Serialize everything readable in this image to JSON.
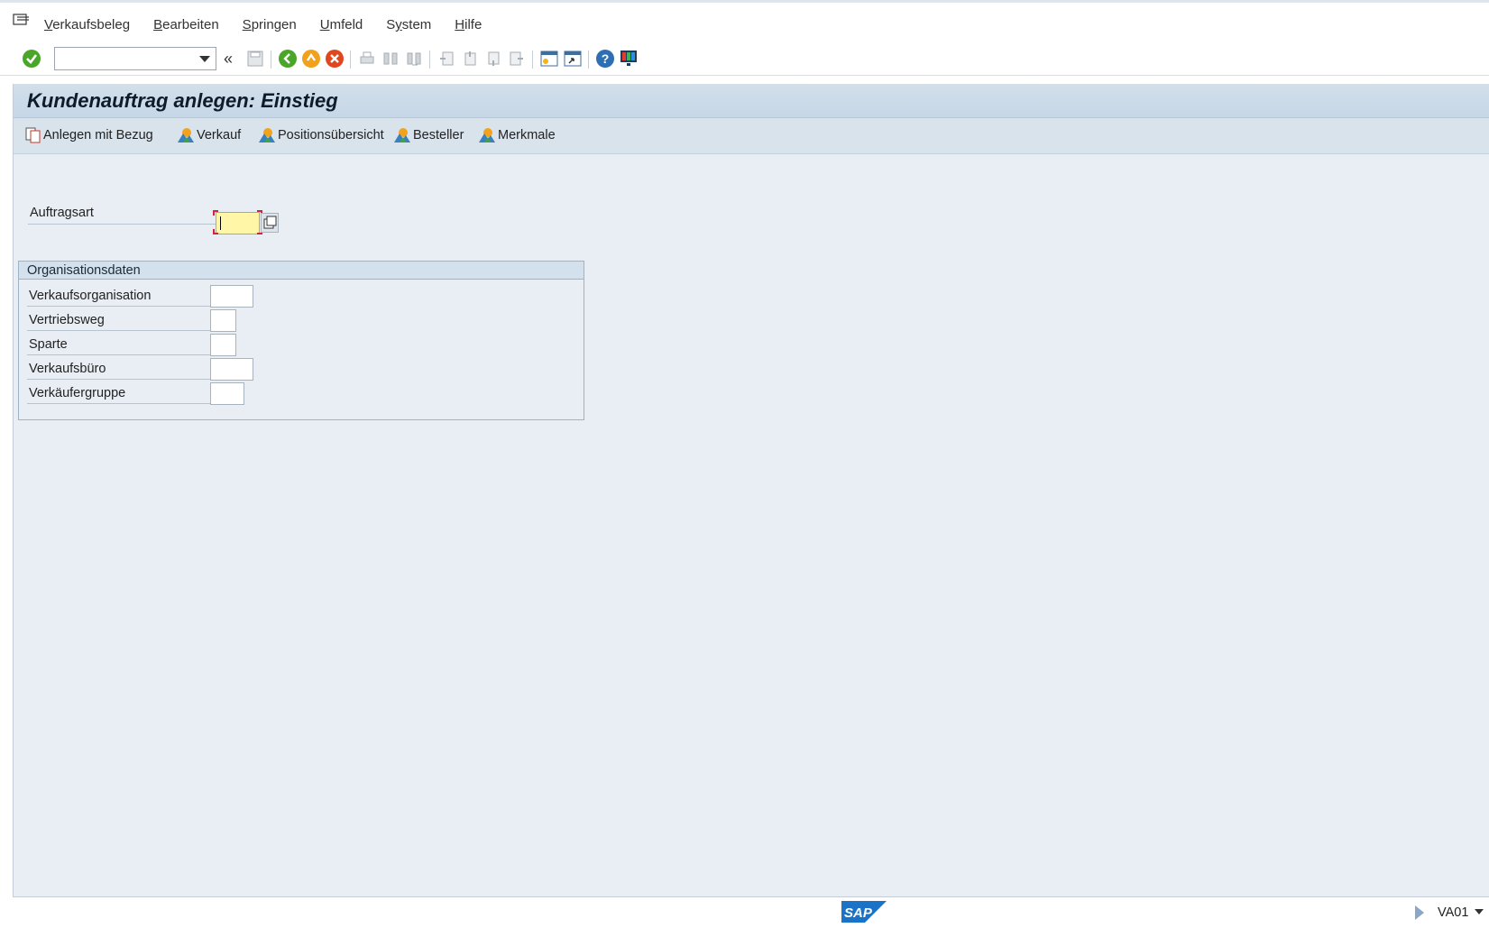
{
  "menubar": {
    "items": [
      {
        "label": "Verkaufsbeleg",
        "mnemonic": "V"
      },
      {
        "label": "Bearbeiten",
        "mnemonic": "B"
      },
      {
        "label": "Springen",
        "mnemonic": "S"
      },
      {
        "label": "Umfeld",
        "mnemonic": "U"
      },
      {
        "label": "System",
        "mnemonic": "y"
      },
      {
        "label": "Hilfe",
        "mnemonic": "H"
      }
    ]
  },
  "toolbar": {
    "command_field_value": "",
    "icons": [
      "enter-icon",
      "command-dropdown",
      "collapse-chevron-icon",
      "save-icon",
      "back-icon",
      "exit-icon",
      "cancel-icon",
      "print-icon",
      "find-icon",
      "find-next-icon",
      "first-page-icon",
      "previous-page-icon",
      "next-page-icon",
      "last-page-icon",
      "new-session-icon",
      "shortcut-icon",
      "help-icon",
      "customize-layout-icon"
    ]
  },
  "screen": {
    "title": "Kundenauftrag anlegen: Einstieg"
  },
  "app_toolbar": {
    "buttons": [
      {
        "label": "Anlegen mit Bezug",
        "icon": "copy-icon"
      },
      {
        "label": "Verkauf",
        "icon": "mountain-icon"
      },
      {
        "label": "Positionsübersicht",
        "icon": "mountain-icon"
      },
      {
        "label": "Besteller",
        "icon": "mountain-icon"
      },
      {
        "label": "Merkmale",
        "icon": "mountain-icon"
      }
    ]
  },
  "form": {
    "auftragsart": {
      "label": "Auftragsart",
      "value": "",
      "required": true
    },
    "org_group": {
      "title": "Organisationsdaten",
      "fields": [
        {
          "label": "Verkaufsorganisation",
          "value": ""
        },
        {
          "label": "Vertriebsweg",
          "value": ""
        },
        {
          "label": "Sparte",
          "value": ""
        },
        {
          "label": "Verkaufsbüro",
          "value": ""
        },
        {
          "label": "Verkäufergruppe",
          "value": ""
        }
      ]
    }
  },
  "statusbar": {
    "logo": "SAP",
    "tcode": "VA01"
  }
}
